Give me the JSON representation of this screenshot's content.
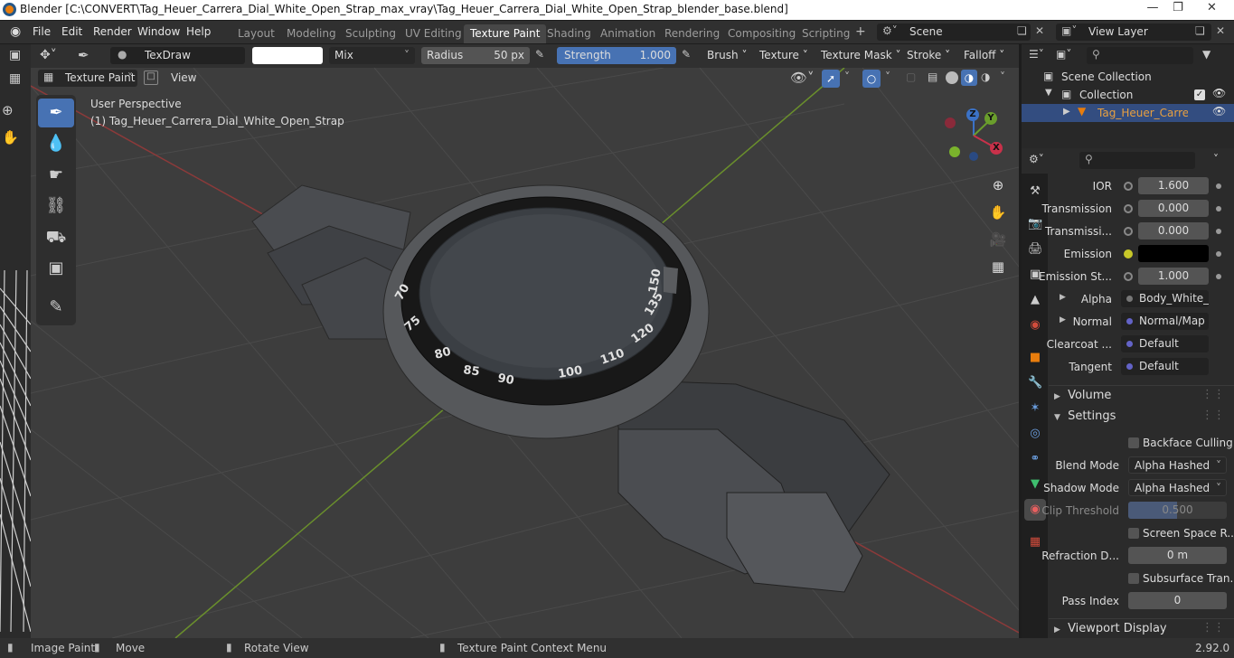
{
  "titlebar": {
    "title": "Blender [C:\\CONVERT\\Tag_Heuer_Carrera_Dial_White_Open_Strap_max_vray\\Tag_Heuer_Carrera_Dial_White_Open_Strap_blender_base.blend]"
  },
  "menu": {
    "file": "File",
    "edit": "Edit",
    "render": "Render",
    "window": "Window",
    "help": "Help"
  },
  "workspaces": [
    "Layout",
    "Modeling",
    "Sculpting",
    "UV Editing",
    "Texture Paint",
    "Shading",
    "Animation",
    "Rendering",
    "Compositing",
    "Scripting"
  ],
  "active_workspace": "Texture Paint",
  "scene": {
    "name": "Scene",
    "view_layer": "View Layer"
  },
  "tool_header": {
    "brush_name": "TexDraw",
    "blend_mode": "Mix",
    "radius_label": "Radius",
    "radius_value": "50 px",
    "strength_label": "Strength",
    "strength_value": "1.000",
    "strength_fraction": 1.0,
    "brush": "Brush",
    "texture": "Texture",
    "texture_mask": "Texture Mask",
    "stroke": "Stroke",
    "falloff": "Falloff"
  },
  "viewport_header": {
    "mode": "Texture Paint",
    "view": "View"
  },
  "viewport": {
    "perspective": "User Perspective",
    "object_info": "(1) Tag_Heuer_Carrera_Dial_White_Open_Strap",
    "bezel_numbers": [
      "70",
      "75",
      "80",
      "85",
      "90",
      "100",
      "110",
      "120",
      "135",
      "150"
    ],
    "gizmo": {
      "x": "X",
      "y": "Y",
      "z": "Z"
    }
  },
  "outliner": {
    "scene_collection": "Scene Collection",
    "collection": "Collection",
    "object": "Tag_Heuer_Carrera_D"
  },
  "properties": {
    "rows": [
      {
        "label": "IOR",
        "value": "1.600"
      },
      {
        "label": "Transmission",
        "value": "0.000"
      },
      {
        "label": "Transmissi...",
        "value": "0.000"
      },
      {
        "label": "Emission",
        "value": ""
      },
      {
        "label": "Emission St...",
        "value": "1.000"
      }
    ],
    "sockets": [
      {
        "label": "Alpha",
        "value": "Body_White_..."
      },
      {
        "label": "Normal",
        "value": "Normal/Map"
      },
      {
        "label": "Clearcoat ...",
        "value": "Default"
      },
      {
        "label": "Tangent",
        "value": "Default"
      }
    ],
    "volume": "Volume",
    "settings": "Settings",
    "backface_culling": "Backface Culling",
    "blend_mode_label": "Blend Mode",
    "blend_mode": "Alpha Hashed",
    "shadow_mode_label": "Shadow Mode",
    "shadow_mode": "Alpha Hashed",
    "clip_threshold_label": "Clip Threshold",
    "clip_threshold": "0.500",
    "screen_space": "Screen Space R...",
    "refraction_label": "Refraction D...",
    "refraction_value": "0 m",
    "subsurface": "Subsurface Tran...",
    "pass_index_label": "Pass Index",
    "pass_index": "0",
    "viewport_display": "Viewport Display"
  },
  "colors": {
    "accent": "#4772b3",
    "object": "#e87d0d",
    "emission": "#000000"
  },
  "statusbar": {
    "image_paint": "Image Paint",
    "move": "Move",
    "rotate": "Rotate View",
    "context": "Texture Paint Context Menu",
    "version": "2.92.0"
  }
}
